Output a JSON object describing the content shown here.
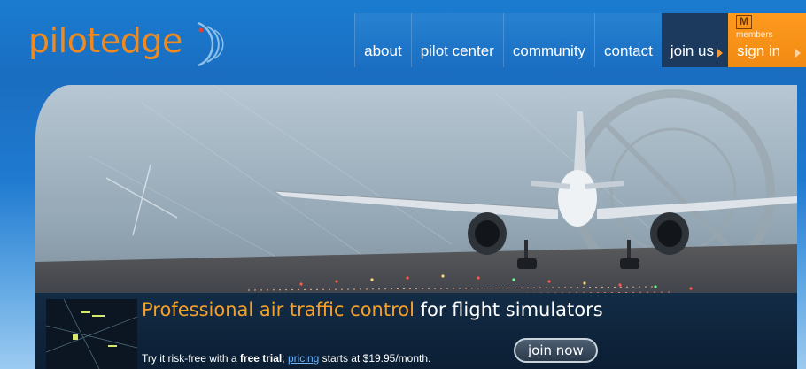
{
  "brand": {
    "logo_text": "pilotedge",
    "logo_color": "#f08a1e"
  },
  "nav": {
    "items": [
      {
        "label": "about"
      },
      {
        "label": "pilot center"
      },
      {
        "label": "community"
      },
      {
        "label": "contact"
      },
      {
        "label": "join us"
      },
      {
        "label": "sign in"
      }
    ],
    "members_badge": "M",
    "members_label": "members"
  },
  "hero": {
    "headline_highlight": "Professional air traffic control",
    "headline_rest": " for flight simulators",
    "sub_prefix": "Try it risk-free with a ",
    "sub_bold": "free trial",
    "sub_mid": "; ",
    "sub_link": "pricing",
    "sub_suffix": " starts at $19.95/month.",
    "cta_label": "join now"
  },
  "colors": {
    "accent_orange": "#f08a1e",
    "nav_blue": "#1a73c7",
    "joinus_bg": "#1b3a5e",
    "link_blue": "#6fb4ff"
  }
}
